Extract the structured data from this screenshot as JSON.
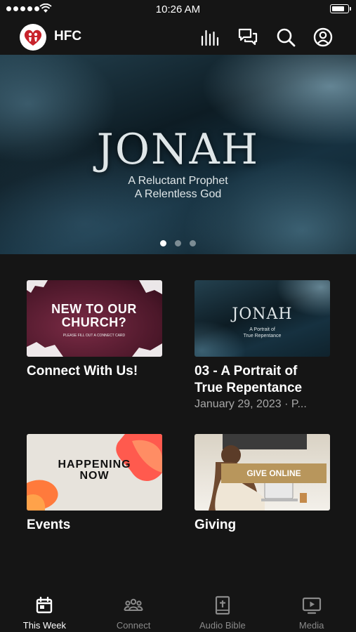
{
  "status_bar": {
    "time": "10:26 AM",
    "battery_level": 0.85
  },
  "header": {
    "brand": "HFC"
  },
  "hero": {
    "title": "JONAH",
    "subtitle_line1": "A Reluctant Prophet",
    "subtitle_line2": "A Relentless God",
    "slide_count": 3,
    "active_slide": 1
  },
  "cards": [
    {
      "title": "Connect With Us!",
      "image_text_1": "NEW TO OUR",
      "image_text_2": "CHURCH?",
      "image_small": "PLEASE FILL OUT A CONNECT CARD"
    },
    {
      "title_line1": "03 - A Portrait of",
      "title_line2": "True Repentance",
      "meta": "January 29, 2023 · P...",
      "image_title": "JONAH",
      "image_sub_1": "A Portrait of",
      "image_sub_2": "True Repentance"
    },
    {
      "title": "Events",
      "image_text_1": "HAPPENING",
      "image_text_2": "NOW"
    },
    {
      "title": "Giving",
      "image_text": "GIVE ONLINE"
    }
  ],
  "tabs": [
    {
      "label": "This Week",
      "icon": "calendar-icon",
      "active": true
    },
    {
      "label": "Connect",
      "icon": "people-icon",
      "active": false
    },
    {
      "label": "Audio Bible",
      "icon": "bible-icon",
      "active": false
    },
    {
      "label": "Media",
      "icon": "play-icon",
      "active": false
    }
  ],
  "colors": {
    "background": "#151515",
    "inactive_tab": "#8a8a8a",
    "logo_red": "#c8232c"
  }
}
